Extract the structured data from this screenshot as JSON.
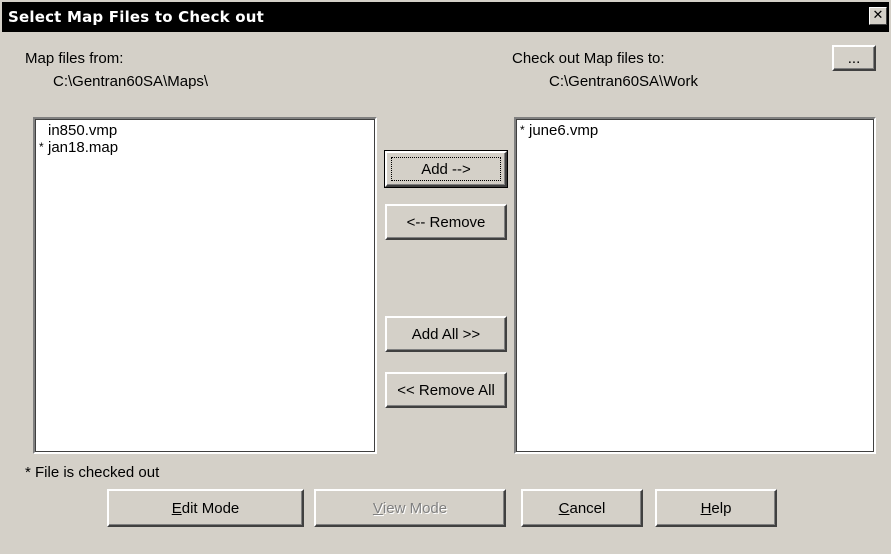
{
  "window": {
    "title": "Select Map Files to Check out",
    "close_label": "✕"
  },
  "source": {
    "label": "Map files from:",
    "path": "C:\\Gentran60SA\\Maps\\",
    "files": [
      {
        "marker": "",
        "name": "in850.vmp"
      },
      {
        "marker": "*",
        "name": "jan18.map"
      }
    ]
  },
  "target": {
    "label": "Check out Map files to:",
    "path": "C:\\Gentran60SA\\Work",
    "browse_label": "...",
    "files": [
      {
        "marker": "*",
        "name": "june6.vmp"
      }
    ]
  },
  "transfer": {
    "add_label": "Add -->",
    "remove_label": "<-- Remove",
    "add_all_label": "Add All  >>",
    "remove_all_label": "<< Remove All"
  },
  "legend": "* File is checked out",
  "footer": {
    "edit_mode": {
      "accel": "E",
      "rest": "dit Mode"
    },
    "view_mode": {
      "accel": "V",
      "rest": "iew Mode",
      "enabled": false
    },
    "cancel": {
      "accel": "C",
      "rest": "ancel"
    },
    "help": {
      "accel": "H",
      "rest": "elp"
    }
  }
}
